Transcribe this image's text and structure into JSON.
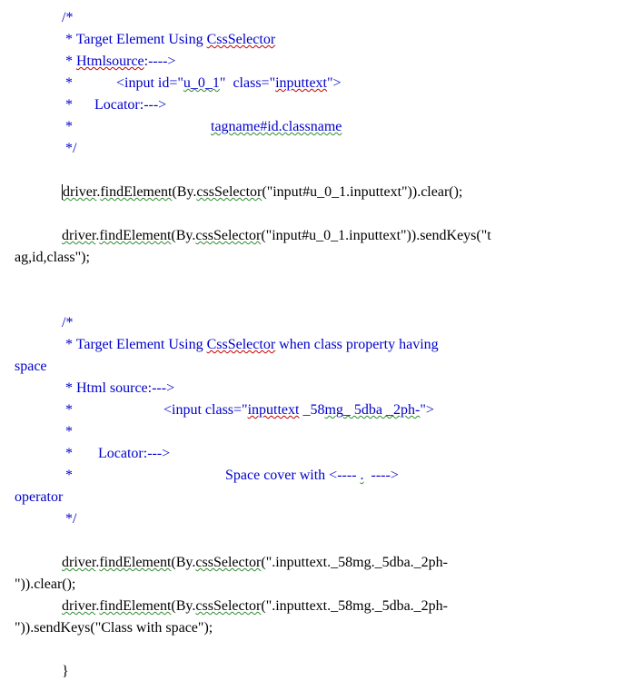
{
  "block1": {
    "l1a": "             /*",
    "l2a": "              * Target Element Using ",
    "l2b": "CssSelector",
    "l3a": "              * ",
    "l3b": "Htmlsource",
    "l3c": ":---->",
    "l4a": "              *            <input id=\"",
    "l4b": "u_0_1",
    "l4c": "\"  class=\"",
    "l4d": "inputtext",
    "l4e": "\">",
    "l5a": "              *      Locator:--->",
    "l6a": "              *                                      ",
    "l6b": "tagname#id.classname",
    "l7a": "              */"
  },
  "stmt1": {
    "indent": "             ",
    "d": "driver",
    "dot1": ".",
    "fe": "findElement",
    "open": "(By.",
    "css": "cssSelector",
    "arg": "(\"input#u_0_1.inputtext\")).clear();"
  },
  "stmt2": {
    "indent": "             ",
    "d": "driver",
    "dot1": ".",
    "fe": "findElement",
    "open": "(By.",
    "css": "cssSelector",
    "arg": "(\"input#u_0_1.inputtext\")).sendKeys(\"t",
    "cont": "ag,id,class\");"
  },
  "block2": {
    "l1a": "             /*",
    "l2a": "              * Target Element Using ",
    "l2b": "CssSelector",
    "l2c": " when class property having",
    "l2d": "space",
    "l3a": "              * Html source:--->",
    "l4a": "              *                         <input class=\"",
    "l4b": "inputtext",
    "l4c": " _58",
    "l4d": "mg",
    "l4e": "_ 5dba _2ph-",
    "l4f": "\">",
    "l5a": "              *",
    "l6a": "              *       Locator:--->",
    "l7a": "              *                                          Space cover with <---- ",
    "l7b": ".",
    "l7c": "  ---->",
    "l7d": "operator",
    "l8a": "              */"
  },
  "stmt3": {
    "indent": "             ",
    "d": "driver",
    "dot1": ".",
    "fe": "findElement",
    "open": "(By.",
    "css": "cssSelector",
    "arg": "(\".inputtext._58mg._5dba._2ph-",
    "cont": "\")).clear();"
  },
  "stmt4": {
    "indent": "             ",
    "d": "driver",
    "dot1": ".",
    "fe": "findElement",
    "open": "(By.",
    "css": "cssSelector",
    "arg": "(\".inputtext._58mg._5dba._2ph-",
    "cont": "\")).sendKeys(\"Class with space\");"
  },
  "closing": "             }"
}
